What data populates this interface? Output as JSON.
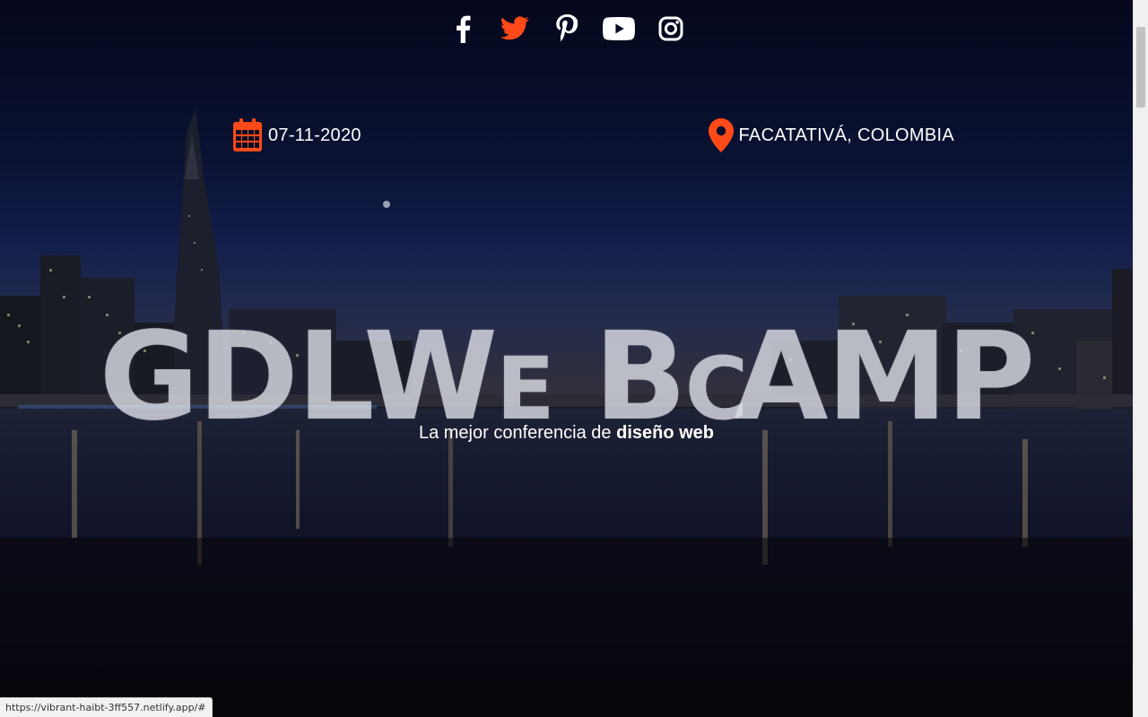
{
  "social": [
    {
      "name": "facebook-icon",
      "color": "#ffffff"
    },
    {
      "name": "twitter-icon",
      "color": "#fe4918"
    },
    {
      "name": "pinterest-icon",
      "color": "#ffffff"
    },
    {
      "name": "youtube-icon",
      "color": "#ffffff"
    },
    {
      "name": "instagram-icon",
      "color": "#ffffff"
    }
  ],
  "event": {
    "date": "07-11-2020",
    "location": "FACATATIVÁ, COLOMBIA",
    "accent_color": "#fe4918"
  },
  "hero": {
    "title_part1": "GDLW",
    "title_e": "E",
    "title_b": "B",
    "title_c": "C",
    "title_part2": "AMP",
    "tagline_prefix": "La mejor conferencia de ",
    "tagline_bold": "diseño web"
  },
  "status": {
    "url": "https://vibrant-haibt-3ff557.netlify.app/#"
  }
}
